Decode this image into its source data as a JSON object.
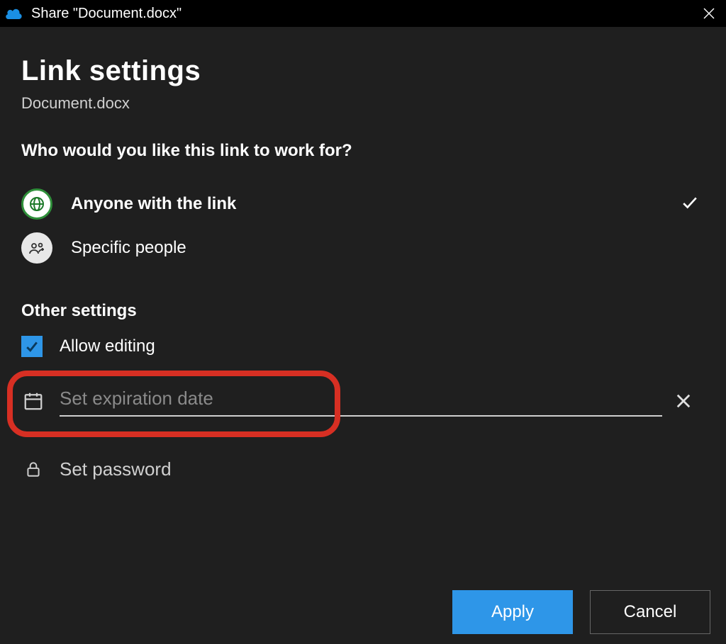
{
  "titlebar": {
    "title": "Share \"Document.docx\""
  },
  "header": {
    "title": "Link settings",
    "subtitle": "Document.docx",
    "question": "Who would you like this link to work for?"
  },
  "options": {
    "anyone": "Anyone with the link",
    "specific": "Specific people",
    "selected": "anyone"
  },
  "other": {
    "section": "Other settings",
    "allow_editing": "Allow editing",
    "expiration_placeholder": "Set expiration date",
    "expiration_value": "",
    "password": "Set password"
  },
  "footer": {
    "apply": "Apply",
    "cancel": "Cancel"
  },
  "colors": {
    "accent": "#2e96e8",
    "annotation": "#d72f23",
    "selected_ring": "#2f8f3a"
  }
}
